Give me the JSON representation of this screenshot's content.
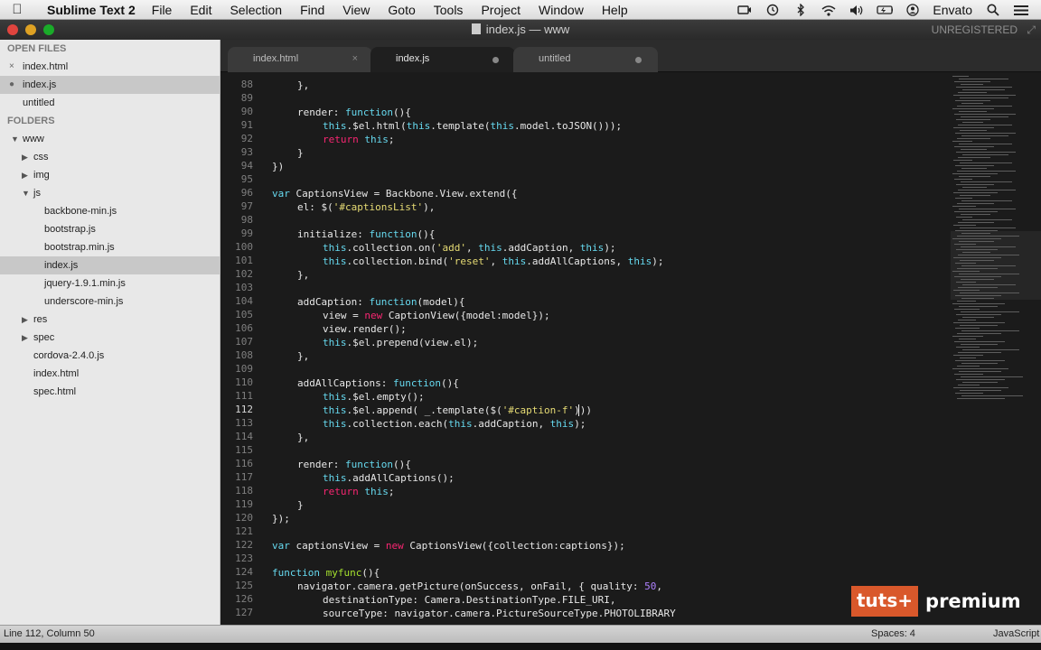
{
  "menubar": {
    "app_name": "Sublime Text 2",
    "items": [
      "File",
      "Edit",
      "Selection",
      "Find",
      "View",
      "Goto",
      "Tools",
      "Project",
      "Window",
      "Help"
    ],
    "user": "Envato",
    "tray_icons": [
      "camera-icon",
      "time-machine-icon",
      "bluetooth-icon",
      "wifi-icon",
      "volume-icon",
      "battery-icon",
      "user-icon"
    ]
  },
  "window": {
    "title": "index.js — www",
    "license_status": "UNREGISTERED"
  },
  "sidebar": {
    "open_files_heading": "OPEN FILES",
    "open_files": [
      {
        "name": "index.html",
        "mark": "×",
        "selected": false
      },
      {
        "name": "index.js",
        "mark": "●",
        "selected": true
      },
      {
        "name": "untitled",
        "mark": "",
        "selected": false
      }
    ],
    "folders_heading": "FOLDERS",
    "tree": [
      {
        "name": "www",
        "depth": 0,
        "type": "folder-open"
      },
      {
        "name": "css",
        "depth": 1,
        "type": "folder-closed"
      },
      {
        "name": "img",
        "depth": 1,
        "type": "folder-closed"
      },
      {
        "name": "js",
        "depth": 1,
        "type": "folder-open"
      },
      {
        "name": "backbone-min.js",
        "depth": 2,
        "type": "file"
      },
      {
        "name": "bootstrap.js",
        "depth": 2,
        "type": "file"
      },
      {
        "name": "bootstrap.min.js",
        "depth": 2,
        "type": "file"
      },
      {
        "name": "index.js",
        "depth": 2,
        "type": "file",
        "selected": true
      },
      {
        "name": "jquery-1.9.1.min.js",
        "depth": 2,
        "type": "file"
      },
      {
        "name": "underscore-min.js",
        "depth": 2,
        "type": "file"
      },
      {
        "name": "res",
        "depth": 1,
        "type": "folder-closed"
      },
      {
        "name": "spec",
        "depth": 1,
        "type": "folder-closed"
      },
      {
        "name": "cordova-2.4.0.js",
        "depth": 1,
        "type": "file"
      },
      {
        "name": "index.html",
        "depth": 1,
        "type": "file"
      },
      {
        "name": "spec.html",
        "depth": 1,
        "type": "file"
      }
    ]
  },
  "tabs": [
    {
      "label": "index.html",
      "status": "×",
      "active": false,
      "dirty": false
    },
    {
      "label": "index.js",
      "status": "",
      "active": true,
      "dirty": true
    },
    {
      "label": "untitled",
      "status": "",
      "active": false,
      "dirty": true
    }
  ],
  "editor": {
    "current_line": 112,
    "lines": [
      {
        "n": "88",
        "indent": 1,
        "tokens": [
          [
            "p",
            "},"
          ]
        ]
      },
      {
        "n": "89",
        "indent": 0,
        "tokens": []
      },
      {
        "n": "90",
        "indent": 1,
        "tokens": [
          [
            "p",
            "render: "
          ],
          [
            "kw",
            "function"
          ],
          [
            "p",
            "(){"
          ]
        ]
      },
      {
        "n": "91",
        "indent": 2,
        "tokens": [
          [
            "kw",
            "this"
          ],
          [
            "p",
            ".$el.html("
          ],
          [
            "kw",
            "this"
          ],
          [
            "p",
            ".template("
          ],
          [
            "kw",
            "this"
          ],
          [
            "p",
            ".model.toJSON()));"
          ]
        ]
      },
      {
        "n": "92",
        "indent": 2,
        "tokens": [
          [
            "kw2",
            "return"
          ],
          [
            "p",
            " "
          ],
          [
            "kw",
            "this"
          ],
          [
            "p",
            ";"
          ]
        ]
      },
      {
        "n": "93",
        "indent": 1,
        "tokens": [
          [
            "p",
            "}"
          ]
        ]
      },
      {
        "n": "94",
        "indent": 0,
        "tokens": [
          [
            "p",
            "})"
          ]
        ]
      },
      {
        "n": "95",
        "indent": 0,
        "tokens": []
      },
      {
        "n": "96",
        "indent": 0,
        "tokens": [
          [
            "kw",
            "var"
          ],
          [
            "p",
            " CaptionsView = Backbone.View.extend({"
          ]
        ]
      },
      {
        "n": "97",
        "indent": 1,
        "tokens": [
          [
            "p",
            "el: $("
          ],
          [
            "str",
            "'#captionsList'"
          ],
          [
            "p",
            "),"
          ]
        ]
      },
      {
        "n": "98",
        "indent": 0,
        "tokens": []
      },
      {
        "n": "99",
        "indent": 1,
        "tokens": [
          [
            "p",
            "initialize: "
          ],
          [
            "kw",
            "function"
          ],
          [
            "p",
            "(){"
          ]
        ]
      },
      {
        "n": "100",
        "indent": 2,
        "tokens": [
          [
            "kw",
            "this"
          ],
          [
            "p",
            ".collection.on("
          ],
          [
            "str",
            "'add'"
          ],
          [
            "p",
            ", "
          ],
          [
            "kw",
            "this"
          ],
          [
            "p",
            ".addCaption, "
          ],
          [
            "kw",
            "this"
          ],
          [
            "p",
            ");"
          ]
        ]
      },
      {
        "n": "101",
        "indent": 2,
        "tokens": [
          [
            "kw",
            "this"
          ],
          [
            "p",
            ".collection.bind("
          ],
          [
            "str",
            "'reset'"
          ],
          [
            "p",
            ", "
          ],
          [
            "kw",
            "this"
          ],
          [
            "p",
            ".addAllCaptions, "
          ],
          [
            "kw",
            "this"
          ],
          [
            "p",
            ");"
          ]
        ]
      },
      {
        "n": "102",
        "indent": 1,
        "tokens": [
          [
            "p",
            "},"
          ]
        ]
      },
      {
        "n": "103",
        "indent": 0,
        "tokens": []
      },
      {
        "n": "104",
        "indent": 1,
        "tokens": [
          [
            "p",
            "addCaption: "
          ],
          [
            "kw",
            "function"
          ],
          [
            "p",
            "(model){"
          ]
        ]
      },
      {
        "n": "105",
        "indent": 2,
        "tokens": [
          [
            "p",
            "view = "
          ],
          [
            "kw2",
            "new"
          ],
          [
            "p",
            " CaptionView({model:model});"
          ]
        ]
      },
      {
        "n": "106",
        "indent": 2,
        "tokens": [
          [
            "p",
            "view.render();"
          ]
        ]
      },
      {
        "n": "107",
        "indent": 2,
        "tokens": [
          [
            "kw",
            "this"
          ],
          [
            "p",
            ".$el.prepend(view.el);"
          ]
        ]
      },
      {
        "n": "108",
        "indent": 1,
        "tokens": [
          [
            "p",
            "},"
          ]
        ]
      },
      {
        "n": "109",
        "indent": 0,
        "tokens": []
      },
      {
        "n": "110",
        "indent": 1,
        "tokens": [
          [
            "p",
            "addAllCaptions: "
          ],
          [
            "kw",
            "function"
          ],
          [
            "p",
            "(){"
          ]
        ]
      },
      {
        "n": "111",
        "indent": 2,
        "tokens": [
          [
            "kw",
            "this"
          ],
          [
            "p",
            ".$el.empty();"
          ]
        ]
      },
      {
        "n": "112",
        "indent": 2,
        "tokens": [
          [
            "kw",
            "this"
          ],
          [
            "p",
            ".$el.append( _.template($("
          ],
          [
            "str",
            "'#caption-f'"
          ],
          [
            "p",
            ")))"
          ]
        ]
      },
      {
        "n": "113",
        "indent": 2,
        "tokens": [
          [
            "kw",
            "this"
          ],
          [
            "p",
            ".collection.each("
          ],
          [
            "kw",
            "this"
          ],
          [
            "p",
            ".addCaption, "
          ],
          [
            "kw",
            "this"
          ],
          [
            "p",
            ");"
          ]
        ]
      },
      {
        "n": "114",
        "indent": 1,
        "tokens": [
          [
            "p",
            "},"
          ]
        ]
      },
      {
        "n": "115",
        "indent": 0,
        "tokens": []
      },
      {
        "n": "116",
        "indent": 1,
        "tokens": [
          [
            "p",
            "render: "
          ],
          [
            "kw",
            "function"
          ],
          [
            "p",
            "(){"
          ]
        ]
      },
      {
        "n": "117",
        "indent": 2,
        "tokens": [
          [
            "kw",
            "this"
          ],
          [
            "p",
            ".addAllCaptions();"
          ]
        ]
      },
      {
        "n": "118",
        "indent": 2,
        "tokens": [
          [
            "kw2",
            "return"
          ],
          [
            "p",
            " "
          ],
          [
            "kw",
            "this"
          ],
          [
            "p",
            ";"
          ]
        ]
      },
      {
        "n": "119",
        "indent": 1,
        "tokens": [
          [
            "p",
            "}"
          ]
        ]
      },
      {
        "n": "120",
        "indent": 0,
        "tokens": [
          [
            "p",
            "});"
          ]
        ]
      },
      {
        "n": "121",
        "indent": 0,
        "tokens": []
      },
      {
        "n": "122",
        "indent": 0,
        "tokens": [
          [
            "kw",
            "var"
          ],
          [
            "p",
            " captionsView = "
          ],
          [
            "kw2",
            "new"
          ],
          [
            "p",
            " CaptionsView({collection:captions});"
          ]
        ]
      },
      {
        "n": "123",
        "indent": 0,
        "tokens": []
      },
      {
        "n": "124",
        "indent": 0,
        "tokens": [
          [
            "kw",
            "function"
          ],
          [
            "p",
            " "
          ],
          [
            "fn",
            "myfunc"
          ],
          [
            "p",
            "(){"
          ]
        ]
      },
      {
        "n": "125",
        "indent": 1,
        "tokens": [
          [
            "p",
            "navigator.camera.getPicture(onSuccess, onFail, { quality: "
          ],
          [
            "num",
            "50"
          ],
          [
            "p",
            ","
          ]
        ]
      },
      {
        "n": "126",
        "indent": 2,
        "tokens": [
          [
            "p",
            "destinationType: Camera.DestinationType.FILE_URI,"
          ]
        ]
      },
      {
        "n": "127",
        "indent": 2,
        "tokens": [
          [
            "p",
            "sourceType: navigator.camera.PictureSourceType.PHOTOLIBRARY"
          ]
        ]
      }
    ]
  },
  "watermark": {
    "brand": "tuts+",
    "tier": "premium"
  },
  "statusbar": {
    "cursor_position": "Line 112, Column 50",
    "indentation": "Spaces: 4",
    "syntax": "JavaScript"
  }
}
